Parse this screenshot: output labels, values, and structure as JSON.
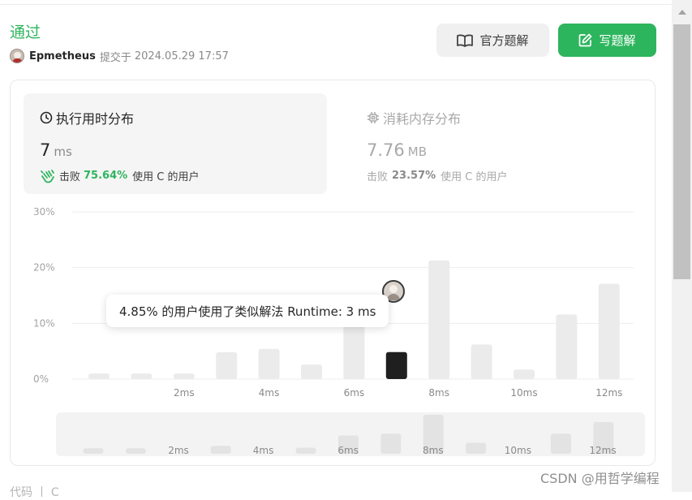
{
  "submission": {
    "status": "通过",
    "username": "Epmetheus",
    "submitted_label": "提交于",
    "datetime": "2024.05.29 17:57"
  },
  "actions": {
    "official_solution": "官方题解",
    "write_solution": "写题解"
  },
  "runtime_panel": {
    "title": "执行用时分布",
    "value": "7",
    "unit": "ms",
    "beats_label": "击败",
    "beats_pct": "75.64%",
    "beats_suffix": "使用 C 的用户"
  },
  "memory_panel": {
    "title": "消耗内存分布",
    "value": "7.76",
    "unit": "MB",
    "beats_label": "击败",
    "beats_pct": "23.57%",
    "beats_suffix": "使用 C 的用户"
  },
  "chart_data": {
    "type": "bar",
    "y_ticks": [
      "30%",
      "20%",
      "10%",
      "0%"
    ],
    "ylim": [
      0,
      30
    ],
    "x_tick_labels": [
      "2ms",
      "4ms",
      "6ms",
      "8ms",
      "10ms",
      "12ms"
    ],
    "values": [
      1.0,
      1.0,
      1.0,
      4.8,
      5.4,
      2.6,
      10.4,
      4.85,
      21.3,
      6.2,
      1.7,
      11.6,
      17.1
    ],
    "highlight_index": 7,
    "highlight_color": "#1f1f1f",
    "bar_color": "#ebebeb",
    "overview_values": [
      0.9,
      0.9,
      0,
      1.3,
      0,
      1.0,
      3.0,
      3.3,
      6.4,
      1.8,
      0,
      3.3,
      5.2
    ],
    "tooltip": "4.85% 的用户使用了类似解法 Runtime: 3 ms"
  },
  "footer": {
    "label": "代码 丨 C"
  },
  "watermark": "CSDN @用哲学编程",
  "colors": {
    "accent": "#2db55d",
    "text": "#262626",
    "muted": "#8a8a8a"
  }
}
